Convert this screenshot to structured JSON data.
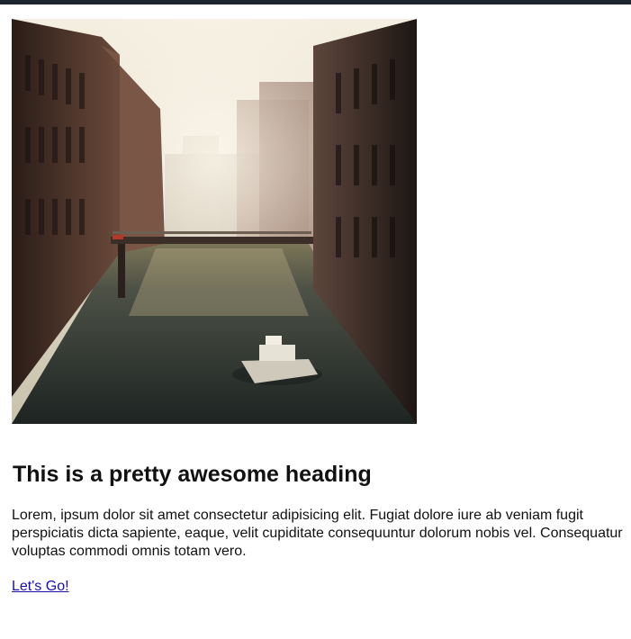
{
  "card": {
    "image_alt": "Canal between brick warehouses with a small boat and a footbridge in hazy sunlight",
    "heading": "This is a pretty awesome heading",
    "body": "Lorem, ipsum dolor sit amet consectetur adipisicing elit. Fugiat dolore iure ab veniam fugit perspiciatis dicta sapiente, eaque, velit cupiditate consequuntur dolorum nobis vel. Consequatur voluptas commodi omnis totam vero.",
    "link_label": "Let's Go!"
  }
}
